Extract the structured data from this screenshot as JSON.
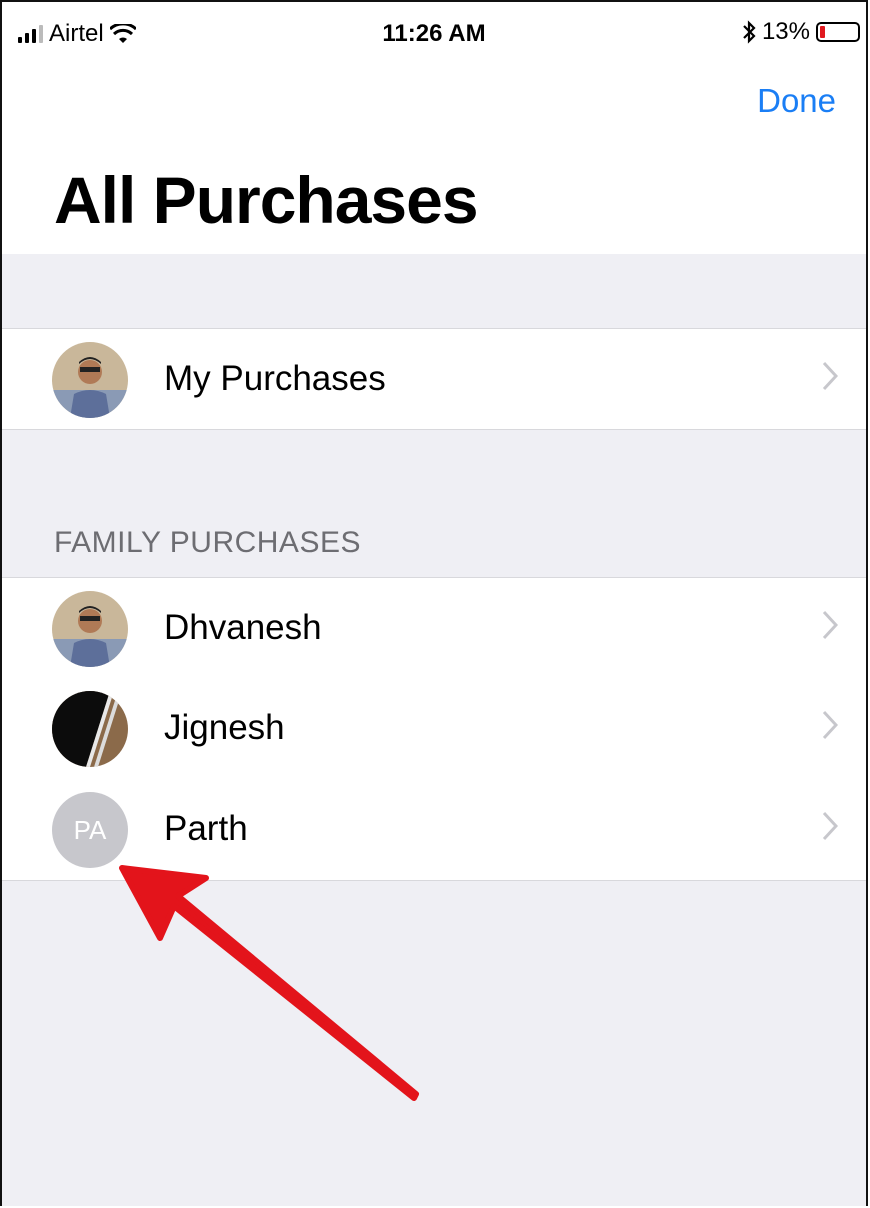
{
  "status_bar": {
    "carrier": "Airtel",
    "time": "11:26 AM",
    "battery_percent": "13%",
    "battery_level": 0.13,
    "icons": [
      "signal-icon",
      "wifi-icon",
      "bluetooth-icon",
      "battery-icon"
    ],
    "battery_color": "#e0191f"
  },
  "nav": {
    "done_label": "Done",
    "title": "All Purchases",
    "accent_color": "#1a7ef5"
  },
  "my_purchases": {
    "label": "My Purchases"
  },
  "family": {
    "header": "FAMILY PURCHASES",
    "members": [
      {
        "name": "Dhvanesh"
      },
      {
        "name": "Jignesh"
      },
      {
        "name": "Parth",
        "initials": "PA"
      }
    ]
  },
  "annotation": {
    "arrow_color": "#e3141b"
  }
}
